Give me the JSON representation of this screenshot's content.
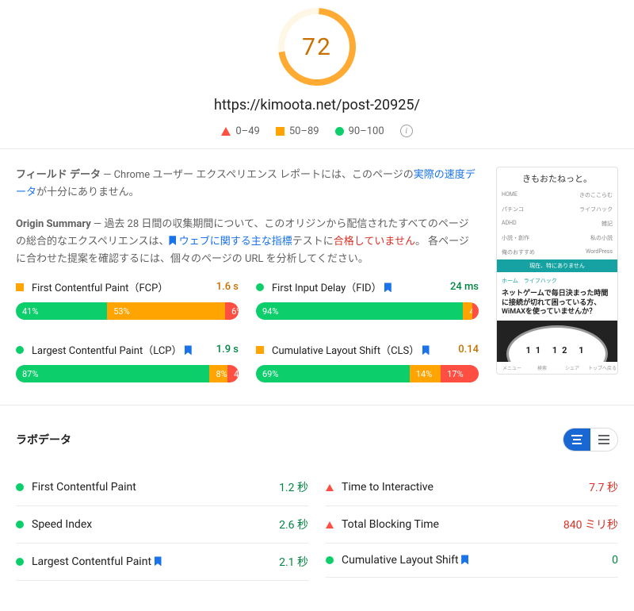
{
  "score": {
    "value": "72"
  },
  "url": "https://kimoota.net/post-20925/",
  "legend": {
    "bad": "0–49",
    "avg": "50–89",
    "good": "90–100"
  },
  "fielddata": {
    "heading": "フィールド データ",
    "text_pre": " — Chrome ユーザー エクスペリエンス レポートには、このページの",
    "text_link": "実際の速度データ",
    "text_post": "が十分にありません。"
  },
  "origin": {
    "heading": "Origin Summary",
    "text_pre": "  — 過去 28 日間の収集期間について、このオリジンから配信されたすべてのページの総合的なエクスペリエンスは、",
    "text_link": "ウェブに関する主な指標",
    "text_mid": "テストに",
    "text_fail": "合格していません",
    "text_post": "。 各ページに合わせた提案を確認するには、個々のページの URL を分析してください。"
  },
  "metrics": {
    "fcp": {
      "label": "First Contentful Paint（FCP）",
      "value": "1.6 s",
      "dist": {
        "g": 41,
        "a": 53,
        "r": 6
      }
    },
    "fid": {
      "label": "First Input Delay（FID）",
      "value": "24 ms",
      "dist": {
        "g": 94,
        "a": 4,
        "r": 3
      }
    },
    "lcp": {
      "label": "Largest Contentful Paint（LCP）",
      "value": "1.9 s",
      "dist": {
        "g": 87,
        "a": 8,
        "r": 4
      }
    },
    "cls": {
      "label": "Cumulative Layout Shift（CLS）",
      "value": "0.14",
      "dist": {
        "g": 69,
        "a": 14,
        "r": 17
      }
    }
  },
  "lab": {
    "heading": "ラボデータ",
    "rows": {
      "fcp": {
        "label": "First Contentful Paint",
        "value": "1.2 秒"
      },
      "si": {
        "label": "Speed Index",
        "value": "2.6 秒"
      },
      "lcp": {
        "label": "Largest Contentful Paint",
        "value": "2.1 秒"
      },
      "tti": {
        "label": "Time to Interactive",
        "value": "7.7 秒"
      },
      "tbt": {
        "label": "Total Blocking Time",
        "value": "840 ミリ秒"
      },
      "cls": {
        "label": "Cumulative Layout Shift",
        "value": "0"
      }
    }
  },
  "thumbnail": {
    "site_title": "きもおたねっと。",
    "nav": [
      "HOME",
      "きのここらむ",
      "パチンコ",
      "ライフハック",
      "ADHD",
      "雑記",
      "小説・創作",
      "私の小説",
      "俺のおすすめ",
      "WordPress"
    ],
    "banner": "現在、特にありません",
    "crumb": "ホーム　ライフハック",
    "post_title": "ネットゲームで毎日決まった時間に接続が切れて困っている方、WiMAXを使っていませんか？",
    "clock": "11 12 1",
    "footer": [
      "メニュー",
      "検索",
      "シェア",
      "トップへ戻る"
    ]
  }
}
